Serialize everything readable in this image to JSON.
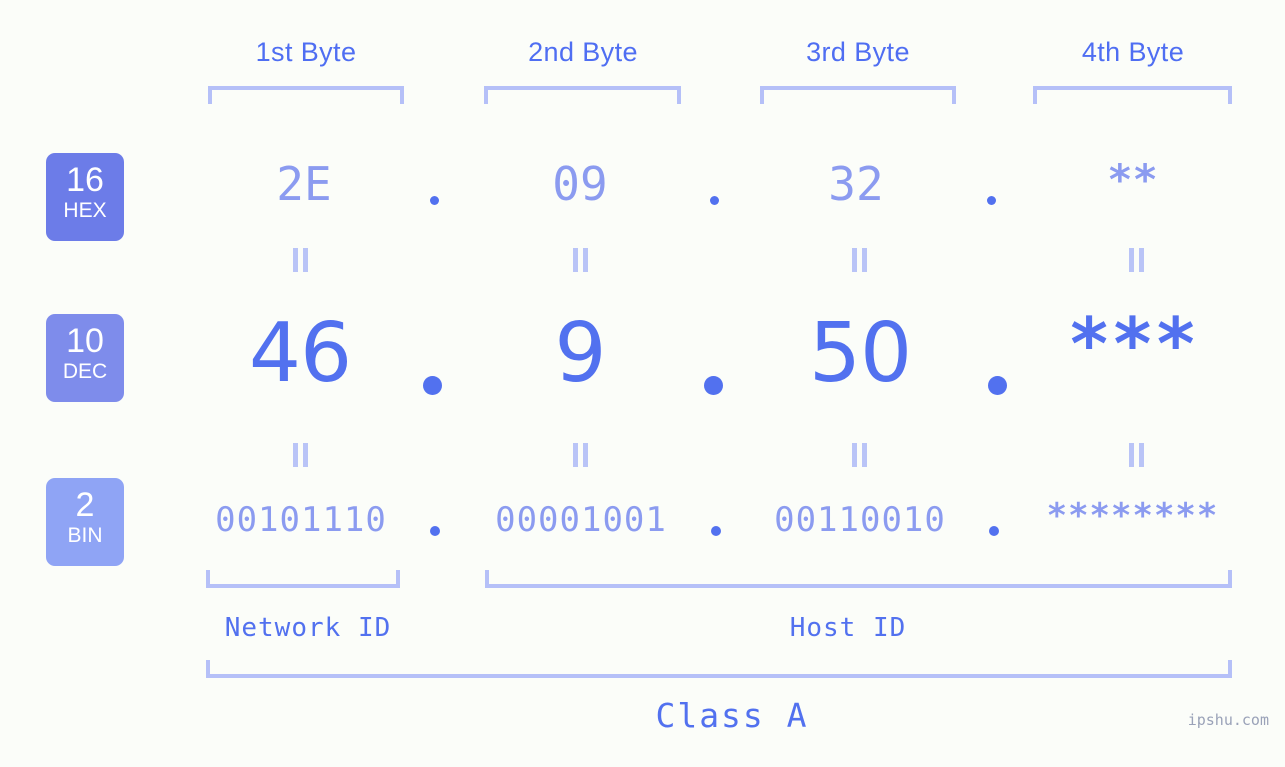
{
  "background": "#fbfdf9",
  "colors": {
    "accent_strong": "#5271ef",
    "accent_light": "#8b9bf0",
    "bracket": "#b5c0f8",
    "header_text": "#4f6ef2",
    "badge_hex": "#6c7ce8",
    "badge_dec": "#7e8ceb",
    "badge_bin": "#8fa4f5",
    "watermark": "#9aa2b8"
  },
  "byte_headers": [
    {
      "label": "1st Byte"
    },
    {
      "label": "2nd Byte"
    },
    {
      "label": "3rd Byte"
    },
    {
      "label": "4th Byte"
    }
  ],
  "bases": [
    {
      "number": "16",
      "name": "HEX"
    },
    {
      "number": "10",
      "name": "DEC"
    },
    {
      "number": "2",
      "name": "BIN"
    }
  ],
  "rows": {
    "hex": {
      "base_number": "16",
      "base_name": "HEX",
      "values": [
        "2E",
        "09",
        "32",
        "**"
      ]
    },
    "dec": {
      "base_number": "10",
      "base_name": "DEC",
      "values": [
        "46",
        "9",
        "50",
        "***"
      ]
    },
    "bin": {
      "base_number": "2",
      "base_name": "BIN",
      "values": [
        "00101110",
        "00001001",
        "00110010",
        "********"
      ]
    }
  },
  "separators": {
    "hex_dot": ".",
    "dec_dot": ".",
    "bin_dot": "."
  },
  "equals_marker": "=",
  "segments": {
    "network_id": "Network ID",
    "host_id": "Host ID",
    "class": "Class A"
  },
  "watermark": "ipshu.com"
}
